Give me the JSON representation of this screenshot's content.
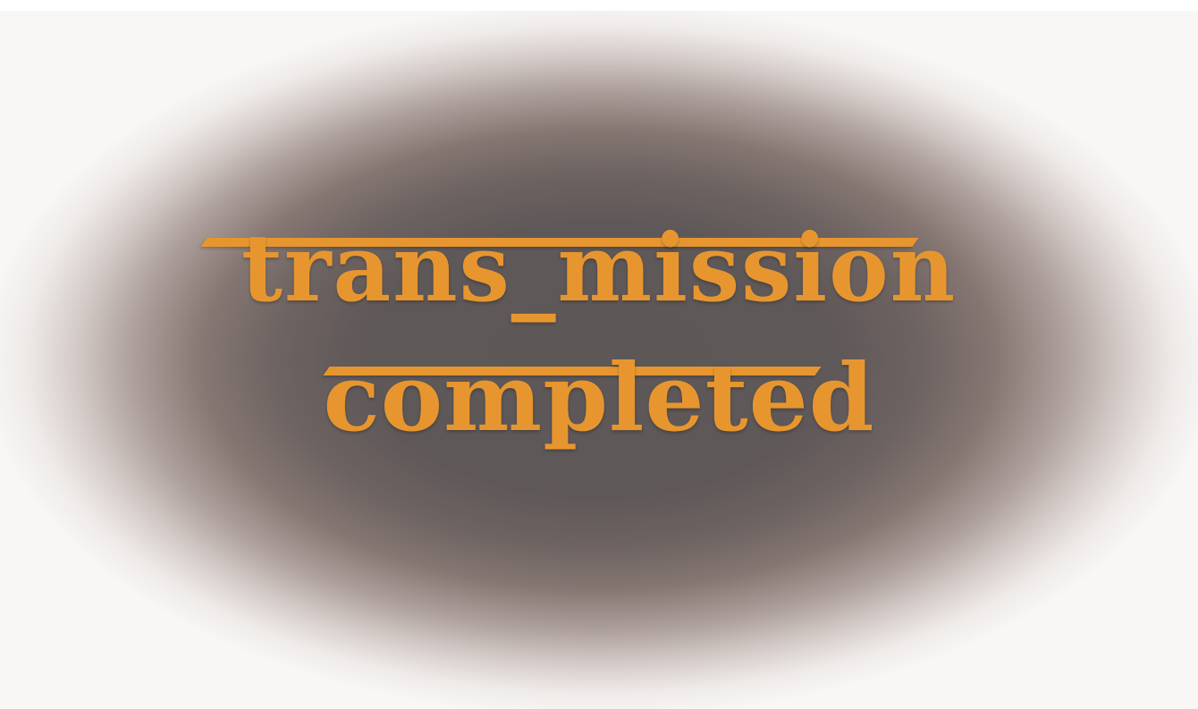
{
  "message": {
    "line_1": "trans_mission",
    "line_2": "completed"
  },
  "colors": {
    "text": "#e7962f",
    "backdrop_center": "#5d5757",
    "backdrop_edge": "#f8f7f6"
  }
}
